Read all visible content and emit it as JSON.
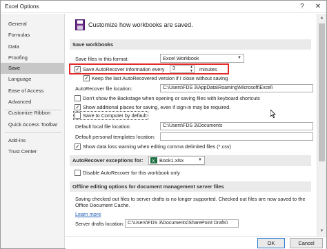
{
  "window": {
    "title": "Excel Options",
    "help": "?",
    "close": "✕"
  },
  "sidebar": {
    "items": [
      {
        "label": "General"
      },
      {
        "label": "Formulas"
      },
      {
        "label": "Data"
      },
      {
        "label": "Proofing"
      },
      {
        "label": "Save",
        "active": true
      },
      {
        "label": "Language"
      },
      {
        "label": "Ease of Access"
      },
      {
        "label": "Advanced"
      },
      {
        "label": "Customize Ribbon"
      },
      {
        "label": "Quick Access Toolbar"
      },
      {
        "label": "Add-ins"
      },
      {
        "label": "Trust Center"
      }
    ]
  },
  "header": {
    "text": "Customize how workbooks are saved."
  },
  "save_workbooks": {
    "title": "Save workbooks",
    "format_label": "Save files in this format:",
    "format_value": "Excel Workbook",
    "autorecover_label": "Save AutoRecover information every",
    "autorecover_checked": true,
    "minutes_value": "3",
    "minutes_label": "minutes",
    "keep_last_label": "Keep the last AutoRecovered version if I close without saving",
    "keep_last_checked": true,
    "ar_location_label": "AutoRecover file location:",
    "ar_location_value": "C:\\Users\\FDS 3\\AppData\\Roaming\\Microsoft\\Excel\\",
    "backstage_label": "Don't show the Backstage when opening or saving files with keyboard shortcuts",
    "backstage_checked": false,
    "additional_label": "Show additional places for saving, even if sign-in may be required.",
    "additional_checked": true,
    "save_computer_label": "Save to Computer by default",
    "save_computer_checked": false,
    "local_location_label": "Default local file location:",
    "local_location_value": "C:\\Users\\FDS 3\\Documents",
    "templates_label": "Default personal templates location:",
    "templates_value": "",
    "data_loss_label": "Show data loss warning when editing comma delimited files (*.csv)",
    "data_loss_checked": true
  },
  "ar_exceptions": {
    "title": "AutoRecover exceptions for:",
    "workbook_value": "Book1.xlsx",
    "disable_label": "Disable AutoRecover for this workbook only",
    "disable_checked": false
  },
  "offline": {
    "title": "Offline editing options for document management server files",
    "desc_line1": "Saving checked out files to server drafts is no longer supported. Checked out files are now saved to the",
    "desc_line2": "Office Document Cache.",
    "learn_more": "Learn more",
    "drafts_label": "Server drafts location:",
    "drafts_value": "C:\\Users\\FDS 3\\Documents\\SharePoint Drafts\\"
  },
  "buttons": {
    "ok": "OK",
    "cancel": "Cancel"
  },
  "colors": {
    "highlight_box": "#e02a2a",
    "excel_green": "#1d6f42",
    "link": "#1f5fb4"
  }
}
